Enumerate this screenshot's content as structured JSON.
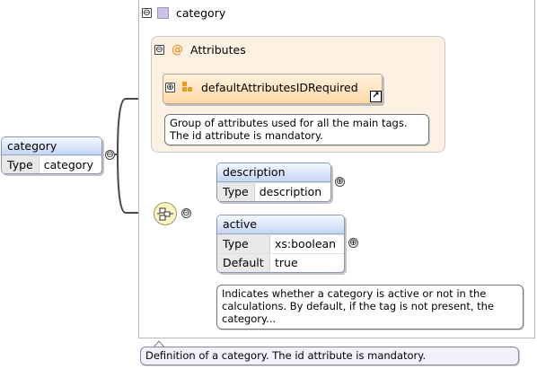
{
  "root_element": {
    "name": "category",
    "rows": [
      {
        "key": "Type",
        "value": "category"
      }
    ]
  },
  "type_frame": {
    "title": "category",
    "doc": "Definition of a category. The id attribute is mandatory."
  },
  "attributes": {
    "title": "Attributes",
    "group_name": "defaultAttributesIDRequired",
    "doc_lines": [
      "Group of attributes used for all the main tags.",
      "The id attribute is mandatory."
    ]
  },
  "children": [
    {
      "name": "description",
      "rows": [
        {
          "key": "Type",
          "value": "description"
        }
      ]
    },
    {
      "name": "active",
      "rows": [
        {
          "key": "Type",
          "value": "xs:boolean"
        },
        {
          "key": "Default",
          "value": "true"
        }
      ],
      "doc_lines": [
        "Indicates whether a category is active or not in the",
        "calculations. By default, if the tag is not present, the",
        "category..."
      ]
    }
  ],
  "symbols": {
    "collapse": "⊖",
    "expand": "⊕",
    "attribute_marker": "@",
    "sequence_icon": "sequence-compositor-icon",
    "link_icon": "external-link-icon"
  },
  "colors": {
    "element_header": "#c4d6f4",
    "attributes_bg": "#fdf1e3",
    "group_ref": "#ffd9a8",
    "type_swatch": "#cbc2e6",
    "sequence_bg": "#fbf4c3",
    "doc_border": "#777777"
  }
}
